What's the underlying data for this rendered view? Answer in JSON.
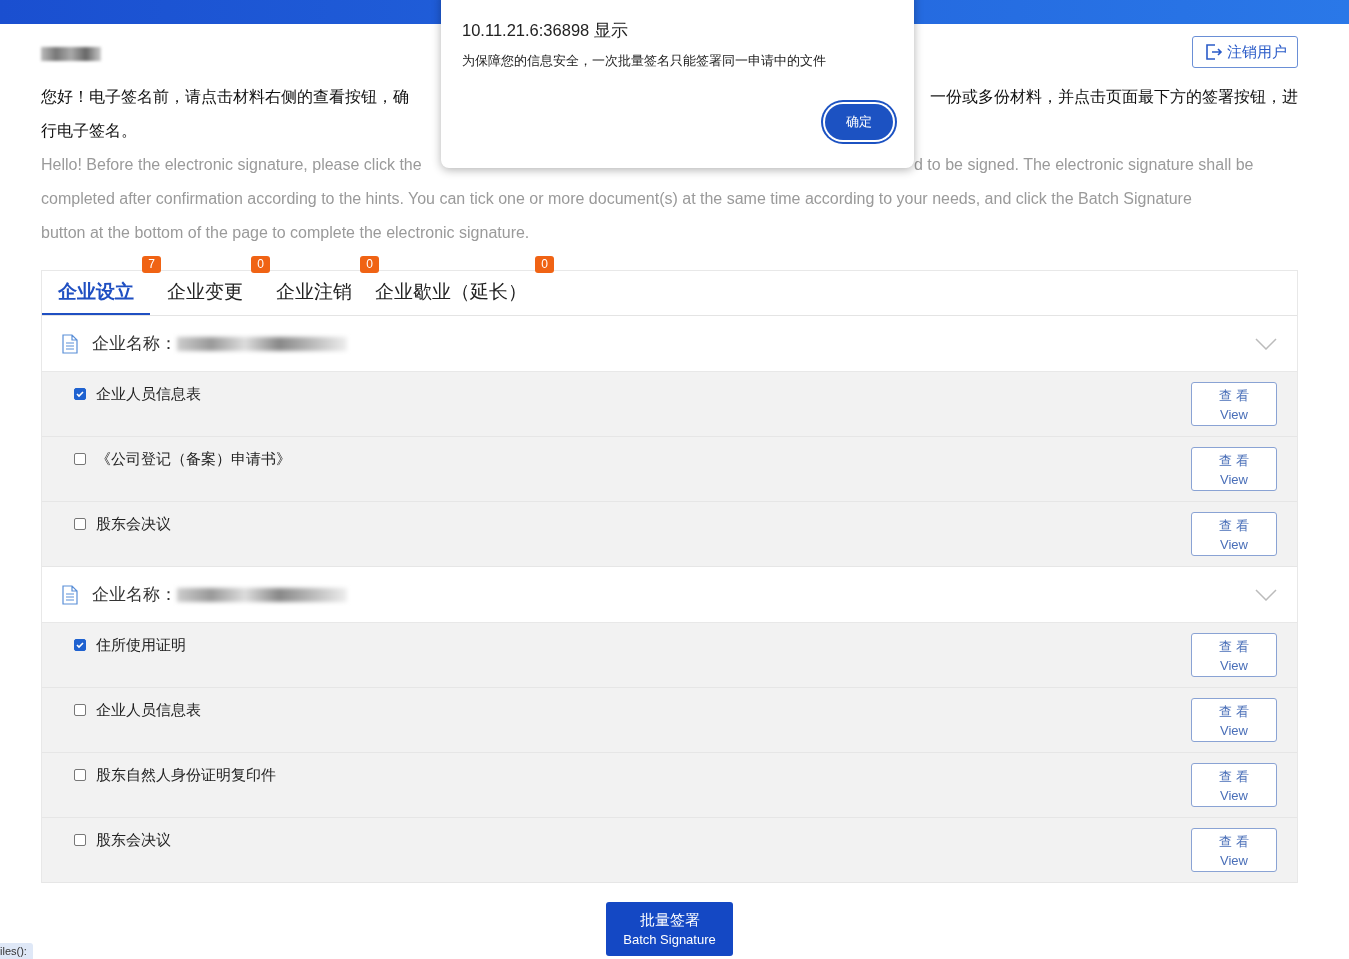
{
  "logout_button": "注销用户",
  "intro_zh": [
    {
      "left": "您好！电子签名前，请点击材料右侧的查看按钮，确",
      "right": "一份或多份材料，并点击页面最下方的签署按钮，进"
    },
    {
      "left": "行电子签名。"
    }
  ],
  "intro_en": [
    {
      "left": "Hello! Before the electronic signature, please click the",
      "right": "d to be signed. The electronic signature shall be"
    },
    {
      "left": "completed after confirmation according to the hints. You can tick one or more document(s) at the same time according to your needs, and click the Batch Signature"
    },
    {
      "left": "button at the bottom of the page to complete the electronic signature."
    }
  ],
  "tabs": [
    {
      "label": "企业设立",
      "badge": "7",
      "selected": true
    },
    {
      "label": "企业变更",
      "badge": "0",
      "selected": false
    },
    {
      "label": "企业注销",
      "badge": "0",
      "selected": false
    },
    {
      "label": "企业歇业（延长）",
      "badge": "0",
      "selected": false
    }
  ],
  "groups": [
    {
      "label": "企业名称：",
      "items": [
        {
          "name": "企业人员信息表",
          "checked": true,
          "view_zh": "查 看",
          "view_en": "View"
        },
        {
          "name": "《公司登记（备案）申请书》",
          "checked": false,
          "view_zh": "查 看",
          "view_en": "View"
        },
        {
          "name": "股东会决议",
          "checked": false,
          "view_zh": "查 看",
          "view_en": "View"
        }
      ]
    },
    {
      "label": "企业名称：",
      "items": [
        {
          "name": "住所使用证明",
          "checked": true,
          "view_zh": "查 看",
          "view_en": "View"
        },
        {
          "name": "企业人员信息表",
          "checked": false,
          "view_zh": "查 看",
          "view_en": "View"
        },
        {
          "name": "股东自然人身份证明复印件",
          "checked": false,
          "view_zh": "查 看",
          "view_en": "View"
        },
        {
          "name": "股东会决议",
          "checked": false,
          "view_zh": "查 看",
          "view_en": "View"
        }
      ]
    }
  ],
  "batch_button": {
    "zh": "批量签署",
    "en": "Batch Signature"
  },
  "files_tag": "iles():",
  "dialog": {
    "title": "10.11.21.6:36898 显示",
    "message": "为保障您的信息安全，一次批量签名只能签署同一申请中的文件",
    "button": "确定"
  }
}
